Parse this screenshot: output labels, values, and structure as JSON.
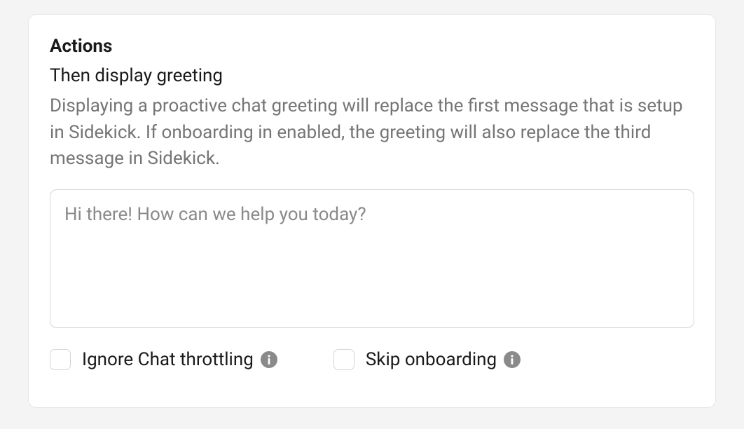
{
  "actions": {
    "title": "Actions",
    "subtitle": "Then display greeting",
    "description": "Displaying a proactive chat greeting will replace the first message that is setup in Sidekick. If onboarding in enabled, the greeting will also replace the third message in Sidekick.",
    "greeting": {
      "placeholder": "Hi there! How can we help you today?",
      "value": ""
    },
    "checkboxes": {
      "ignore_throttling": {
        "label": "Ignore Chat throttling",
        "checked": false
      },
      "skip_onboarding": {
        "label": "Skip onboarding",
        "checked": false
      }
    }
  }
}
